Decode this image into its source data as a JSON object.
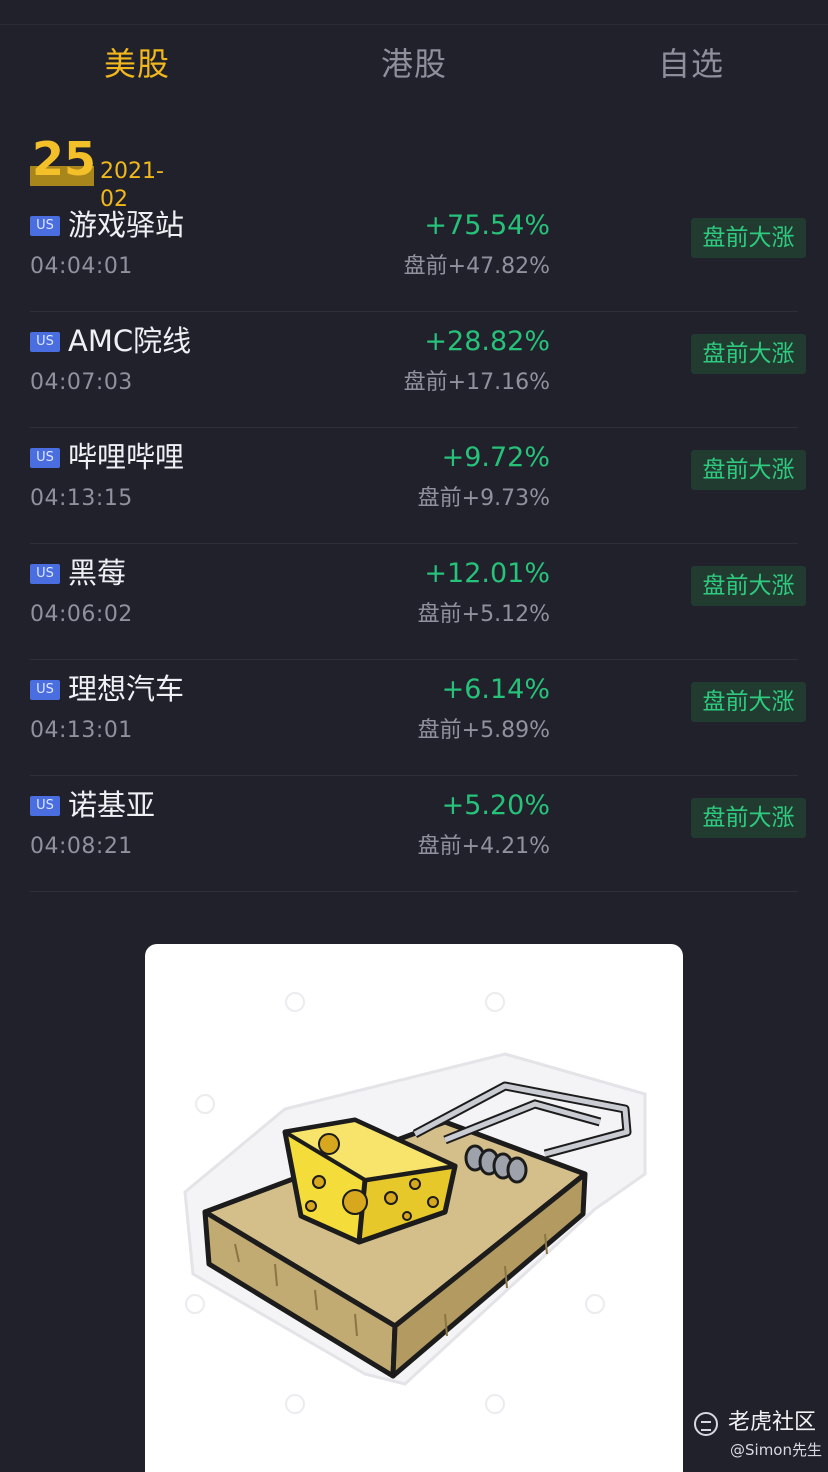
{
  "tabs": [
    {
      "label": "美股",
      "active": true
    },
    {
      "label": "港股",
      "active": false
    },
    {
      "label": "自选",
      "active": false
    }
  ],
  "date": {
    "day": "25",
    "month": "2021-02"
  },
  "stocks": [
    {
      "market": "US",
      "name": "游戏驿站",
      "time": "04:04:01",
      "change": "+75.54%",
      "premarket": "盘前+47.82%",
      "tag": "盘前大涨"
    },
    {
      "market": "US",
      "name": "AMC院线",
      "time": "04:07:03",
      "change": "+28.82%",
      "premarket": "盘前+17.16%",
      "tag": "盘前大涨"
    },
    {
      "market": "US",
      "name": "哔哩哔哩",
      "time": "04:13:15",
      "change": "+9.72%",
      "premarket": "盘前+9.73%",
      "tag": "盘前大涨"
    },
    {
      "market": "US",
      "name": "黑莓",
      "time": "04:06:02",
      "change": "+12.01%",
      "premarket": "盘前+5.12%",
      "tag": "盘前大涨"
    },
    {
      "market": "US",
      "name": "理想汽车",
      "time": "04:13:01",
      "change": "+6.14%",
      "premarket": "盘前+5.89%",
      "tag": "盘前大涨"
    },
    {
      "market": "US",
      "name": "诺基亚",
      "time": "04:08:21",
      "change": "+5.20%",
      "premarket": "盘前+4.21%",
      "tag": "盘前大涨"
    }
  ],
  "watermark": {
    "title": "老虎社区",
    "user": "@Simon先生"
  },
  "colors": {
    "accent": "#f0b81c",
    "up": "#27c27a",
    "background": "#20212b",
    "badge": "#4a6de0"
  },
  "icons": {
    "watermark_logo": "tiger-logo-icon"
  }
}
